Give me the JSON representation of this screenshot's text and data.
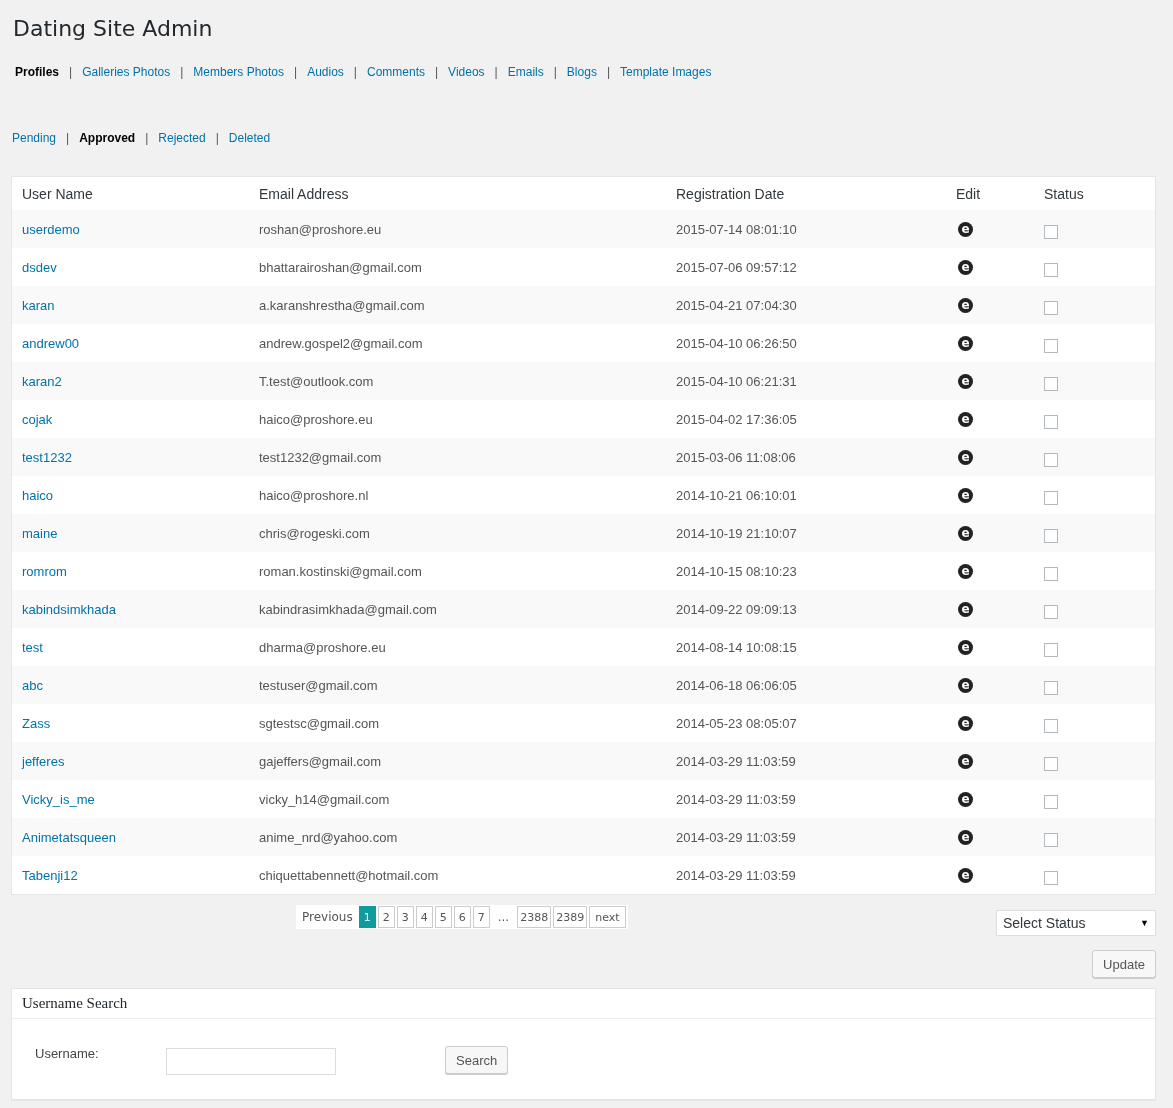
{
  "title": "Dating Site Admin",
  "main_nav": [
    {
      "label": "Profiles",
      "selected": true
    },
    {
      "label": "Galleries Photos",
      "selected": false,
      "separator": "|"
    },
    {
      "label": "Members Photos",
      "selected": false,
      "separator": "|"
    },
    {
      "label": "Audios",
      "selected": false,
      "separator": "|"
    },
    {
      "label": "Comments",
      "selected": false,
      "separator": "|"
    },
    {
      "label": "Videos",
      "selected": false,
      "separator": "|"
    },
    {
      "label": "Emails",
      "selected": false,
      "separator": "|"
    },
    {
      "label": "Blogs",
      "selected": false,
      "separator": "|"
    },
    {
      "label": "Template Images",
      "selected": false,
      "separator": "|"
    }
  ],
  "status_nav": [
    {
      "label": "Pending",
      "selected": false
    },
    {
      "label": "Approved",
      "selected": true,
      "separator": "|"
    },
    {
      "label": "Rejected",
      "selected": false,
      "separator": "|"
    },
    {
      "label": "Deleted",
      "selected": false,
      "separator": "|"
    }
  ],
  "table": {
    "columns": [
      "User Name",
      "Email Address",
      "Registration Date",
      "Edit",
      "Status"
    ],
    "rows": [
      {
        "user": "userdemo",
        "email": "roshan@proshore.eu",
        "date": "2015-07-14 08:01:10",
        "edit": "e",
        "checked": false
      },
      {
        "user": "dsdev",
        "email": "bhattarairoshan@gmail.com",
        "date": "2015-07-06 09:57:12",
        "edit": "e",
        "checked": false
      },
      {
        "user": "karan",
        "email": "a.karanshrestha@gmail.com",
        "date": "2015-04-21 07:04:30",
        "edit": "e",
        "checked": false
      },
      {
        "user": "andrew00",
        "email": "andrew.gospel2@gmail.com",
        "date": "2015-04-10 06:26:50",
        "edit": "e",
        "checked": false
      },
      {
        "user": "karan2",
        "email": "T.test@outlook.com",
        "date": "2015-04-10 06:21:31",
        "edit": "e",
        "checked": false
      },
      {
        "user": "cojak",
        "email": "haico@proshore.eu",
        "date": "2015-04-02 17:36:05",
        "edit": "e",
        "checked": false
      },
      {
        "user": "test1232",
        "email": "test1232@gmail.com",
        "date": "2015-03-06 11:08:06",
        "edit": "e",
        "checked": false
      },
      {
        "user": "haico",
        "email": "haico@proshore.nl",
        "date": "2014-10-21 06:10:01",
        "edit": "e",
        "checked": false
      },
      {
        "user": "maine",
        "email": "chris@rogeski.com",
        "date": "2014-10-19 21:10:07",
        "edit": "e",
        "checked": false
      },
      {
        "user": "romrom",
        "email": "roman.kostinski@gmail.com",
        "date": "2014-10-15 08:10:23",
        "edit": "e",
        "checked": false
      },
      {
        "user": "kabindsimkhada",
        "email": "kabindrasimkhada@gmail.com",
        "date": "2014-09-22 09:09:13",
        "edit": "e",
        "checked": false
      },
      {
        "user": "test",
        "email": "dharma@proshore.eu",
        "date": "2014-08-14 10:08:15",
        "edit": "e",
        "checked": false
      },
      {
        "user": "abc",
        "email": "testuser@gmail.com",
        "date": "2014-06-18 06:06:05",
        "edit": "e",
        "checked": false
      },
      {
        "user": "Zass",
        "email": "sgtestsc@gmail.com",
        "date": "2014-05-23 08:05:07",
        "edit": "e",
        "checked": false
      },
      {
        "user": "jefferes",
        "email": "gajeffers@gmail.com",
        "date": "2014-03-29 11:03:59",
        "edit": "e",
        "checked": false
      },
      {
        "user": "Vicky_is_me",
        "email": "vicky_h14@gmail.com",
        "date": "2014-03-29 11:03:59",
        "edit": "e",
        "checked": false
      },
      {
        "user": "Animetatsqueen",
        "email": "anime_nrd@yahoo.com",
        "date": "2014-03-29 11:03:59",
        "edit": "e",
        "checked": false
      },
      {
        "user": "Tabenji12",
        "email": "chiquettabennett@hotmail.com",
        "date": "2014-03-29 11:03:59",
        "edit": "e",
        "checked": false
      }
    ]
  },
  "pagination": [
    {
      "kind": "prev",
      "label": "Previous"
    },
    {
      "kind": "page",
      "label": "1",
      "selected": true
    },
    {
      "kind": "page",
      "label": "2",
      "selected": false
    },
    {
      "kind": "page",
      "label": "3",
      "selected": false
    },
    {
      "kind": "page",
      "label": "4",
      "selected": false
    },
    {
      "kind": "page",
      "label": "5",
      "selected": false
    },
    {
      "kind": "page",
      "label": "6",
      "selected": false
    },
    {
      "kind": "page",
      "label": "7",
      "selected": false
    },
    {
      "kind": "ellipsis",
      "label": "..."
    },
    {
      "kind": "page",
      "label": "2388",
      "selected": false
    },
    {
      "kind": "page",
      "label": "2389",
      "selected": false
    },
    {
      "kind": "next",
      "label": "next",
      "selected": false
    }
  ],
  "status_select": {
    "value": "Select Status",
    "caret": "▼"
  },
  "update_button": "Update",
  "search_panel": {
    "title": "Username Search",
    "label": "Username:",
    "button": "Search"
  }
}
